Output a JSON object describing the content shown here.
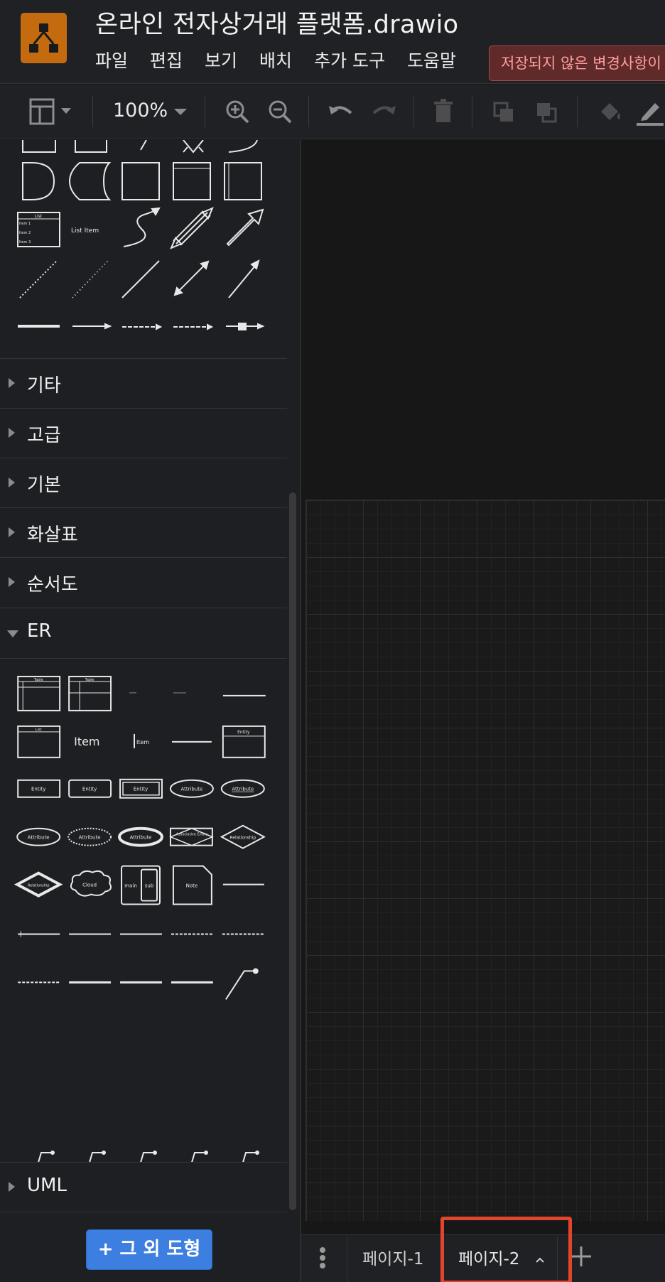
{
  "header": {
    "doc_title": "온라인 전자상거래 플랫폼.drawio",
    "menu": [
      "파일",
      "편집",
      "보기",
      "배치",
      "추가 도구",
      "도움말"
    ],
    "unsaved_label": "저장되지 않은 변경사항이"
  },
  "toolbar": {
    "zoom": "100%",
    "icons": [
      "format-panel-icon",
      "zoom-in-icon",
      "zoom-out-icon",
      "undo-icon",
      "redo-icon",
      "delete-icon",
      "to-front-icon",
      "to-back-icon",
      "fill-color-icon",
      "line-color-icon"
    ]
  },
  "sidebar": {
    "general_shape_labels": {
      "list_header": "List",
      "list_rows": [
        "Item 1",
        "Item 2",
        "Item 3"
      ],
      "list_item": "List Item"
    },
    "categories": [
      "기타",
      "고급",
      "기본",
      "화살표",
      "순서도",
      "ER",
      "UML"
    ],
    "er_shape_labels": {
      "table": "Table",
      "list": "List",
      "item": "Item",
      "entity": "Entity",
      "attribute": "Attribute",
      "associative_entity": "Associative Entity",
      "relationship": "Relationship",
      "cloud": "Cloud",
      "main": "main",
      "sub": "sub",
      "note": "Note"
    },
    "more_shapes_label": "+ 그 외 도형"
  },
  "tabs": {
    "pages": [
      "페이지-1",
      "페이지-2"
    ],
    "active": "페이지-2"
  },
  "colors": {
    "accent": "#3c7fe0",
    "logo": "#c46b10",
    "highlight": "#e2452b",
    "unsaved_text": "#ff9e9e"
  }
}
